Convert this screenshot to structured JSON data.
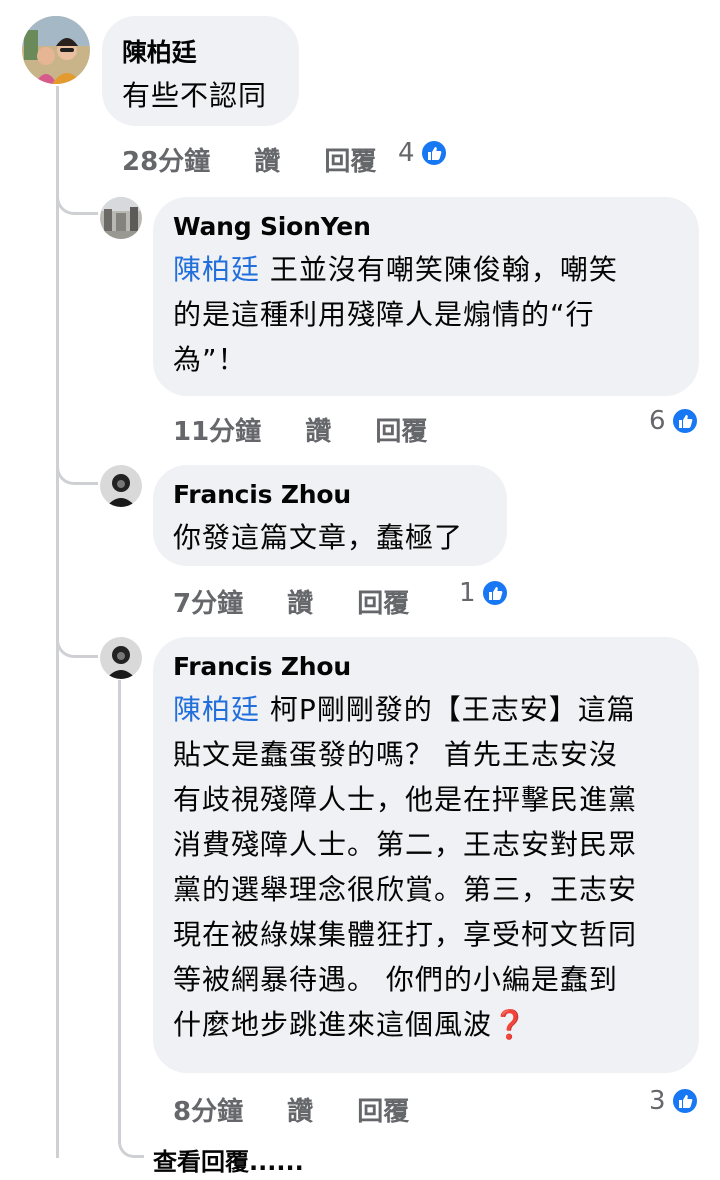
{
  "comment": {
    "author": "陳柏廷",
    "text": "有些不認同",
    "time": "28分鐘",
    "like_label": "讚",
    "reply_label": "回覆",
    "reaction_count": "4"
  },
  "replies": [
    {
      "author": "Wang SionYen",
      "mention": "陳柏廷",
      "lines": [
        " 王並沒有嘲笑陳俊翰，嘲笑",
        "的是這種利用殘障人是煽情的“行",
        "為”！"
      ],
      "time": "11分鐘",
      "like_label": "讚",
      "reply_label": "回覆",
      "reaction_count": "6"
    },
    {
      "author": "Francis Zhou",
      "text": "你發這篇文章，蠢極了",
      "time": "7分鐘",
      "like_label": "讚",
      "reply_label": "回覆",
      "reaction_count": "1"
    },
    {
      "author": "Francis Zhou",
      "mention": "陳柏廷",
      "lines": [
        " 柯P剛剛發的【王志安】這篇",
        "貼文是蠢蛋發的嗎？ 首先王志安沒",
        "有歧視殘障人士，他是在抨擊民進黨",
        "消費殘障人士。第二，王志安對民眾",
        "黨的選舉理念很欣賞。第三，王志安",
        "現在被綠媒集體狂打，享受柯文哲同",
        "等被網暴待遇。 你們的小編是蠢到",
        "什麼地步跳進來這個風波"
      ],
      "end_icon": "❓",
      "time": "8分鐘",
      "like_label": "讚",
      "reply_label": "回覆",
      "reaction_count": "3"
    }
  ],
  "view_replies_label": "查看回覆......",
  "colors": {
    "bubble": "#eff1f4",
    "mention": "#216fdb",
    "like_blue": "#1877f2",
    "meta_gray": "#65676b",
    "thread_line": "#ced0d4"
  }
}
